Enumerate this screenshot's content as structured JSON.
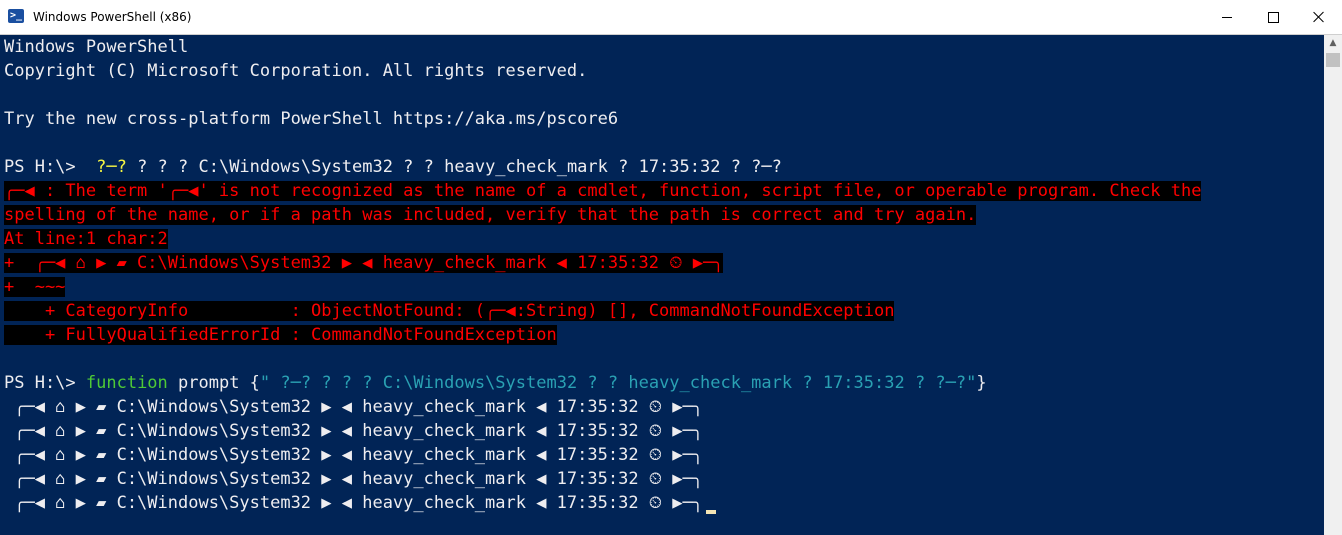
{
  "window": {
    "title": "Windows PowerShell (x86)",
    "icon": "powershell-icon",
    "controls": {
      "minimize": "minimize-icon",
      "maximize": "maximize-icon",
      "close": "close-icon"
    }
  },
  "colors": {
    "background": "#012456",
    "foreground": "#eeedf0",
    "error": "#ff0000",
    "error_background": "#000000",
    "keyword": "#4ec936",
    "string": "#2aa1b3",
    "highlight": "#f5f543"
  },
  "console": {
    "banner": [
      "Windows PowerShell",
      "Copyright (C) Microsoft Corporation. All rights reserved.",
      "Try the new cross-platform PowerShell https://aka.ms/pscore6"
    ],
    "first_prompt": {
      "prefix": "PS H:\\> ",
      "arg_highlight": " ?─?",
      "arg_rest": " ? ? ? C:\\Windows\\System32 ? ? heavy_check_mark ? 17:35:32 ? ?─?"
    },
    "error": {
      "line1": "╭─◀ : The term '╭─◀' is not recognized as the name of a cmdlet, function, script file, or operable program. Check the",
      "line2": "spelling of the name, or if a path was included, verify that the path is correct and try again.",
      "line3": "At line:1 char:2",
      "line4": "+  ╭─◀ ⌂ ▶ ▰ C:\\Windows\\System32 ▶ ◀ heavy_check_mark ◀ 17:35:32 ⏲ ▶─╮",
      "line5": "+  ~~~",
      "line6": "    + CategoryInfo          : ObjectNotFound: (╭─◀:String) [], CommandNotFoundException",
      "line7": "    + FullyQualifiedErrorId : CommandNotFoundException"
    },
    "second_prompt": {
      "prefix": "PS H:\\> ",
      "keyword": "function",
      "name": " prompt {",
      "string": "\" ?─? ? ? ? C:\\Windows\\System32 ? ? heavy_check_mark ? 17:35:32 ? ?─?\"",
      "close": "}"
    },
    "prompt_lines": [
      " ╭─◀ ⌂ ▶ ▰ C:\\Windows\\System32 ▶ ◀ heavy_check_mark ◀ 17:35:32 ⏲ ▶─╮",
      " ╭─◀ ⌂ ▶ ▰ C:\\Windows\\System32 ▶ ◀ heavy_check_mark ◀ 17:35:32 ⏲ ▶─╮",
      " ╭─◀ ⌂ ▶ ▰ C:\\Windows\\System32 ▶ ◀ heavy_check_mark ◀ 17:35:32 ⏲ ▶─╮",
      " ╭─◀ ⌂ ▶ ▰ C:\\Windows\\System32 ▶ ◀ heavy_check_mark ◀ 17:35:32 ⏲ ▶─╮",
      " ╭─◀ ⌂ ▶ ▰ C:\\Windows\\System32 ▶ ◀ heavy_check_mark ◀ 17:35:32 ⏲ ▶─╮"
    ]
  }
}
